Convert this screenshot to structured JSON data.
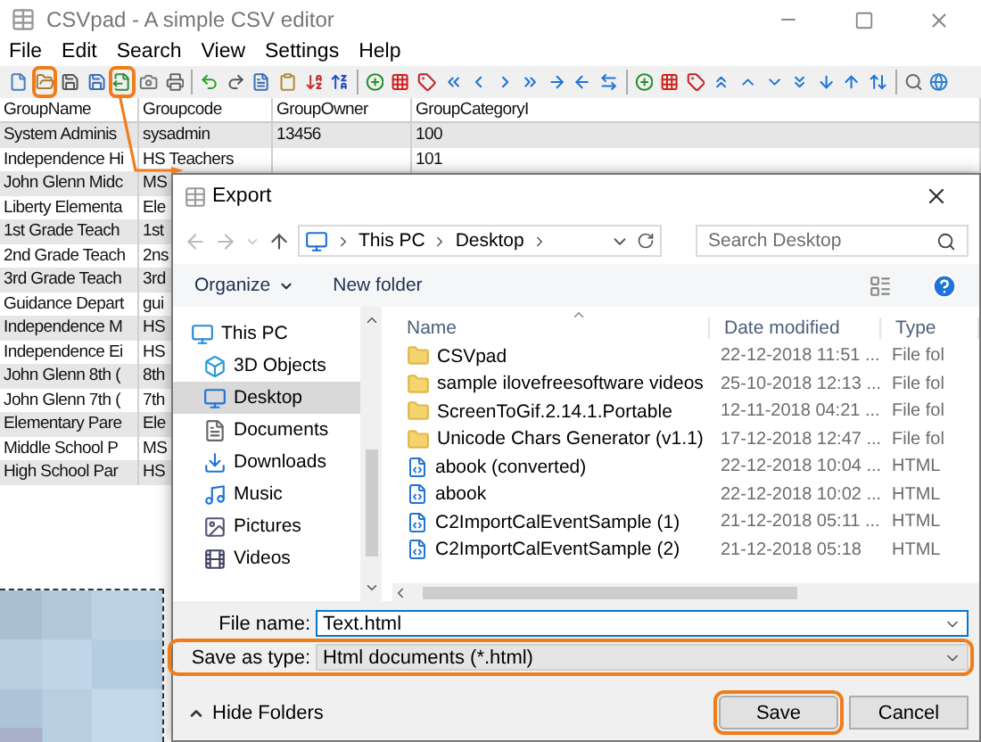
{
  "window": {
    "title": "CSVpad - A simple CSV editor"
  },
  "menu": [
    "File",
    "Edit",
    "Search",
    "View",
    "Settings",
    "Help"
  ],
  "toolbar": [
    {
      "kind": "new",
      "highlighted": false
    },
    {
      "kind": "open",
      "highlighted": true
    },
    {
      "kind": "save",
      "highlighted": false
    },
    {
      "kind": "saveas",
      "highlighted": false
    },
    {
      "kind": "export",
      "highlighted": true
    },
    {
      "kind": "camera",
      "highlighted": false
    },
    {
      "kind": "print",
      "highlighted": false
    },
    {
      "kind": "sep"
    },
    {
      "kind": "undo",
      "highlighted": false
    },
    {
      "kind": "redo",
      "highlighted": false
    },
    {
      "kind": "page",
      "highlighted": false
    },
    {
      "kind": "clipboard",
      "highlighted": false
    },
    {
      "kind": "sortaz",
      "highlighted": false
    },
    {
      "kind": "sortza",
      "highlighted": false
    },
    {
      "kind": "sep"
    },
    {
      "kind": "plus",
      "highlighted": false
    },
    {
      "kind": "grid",
      "highlighted": false
    },
    {
      "kind": "tag",
      "highlighted": false
    },
    {
      "kind": "dleft",
      "highlighted": false
    },
    {
      "kind": "left",
      "highlighted": false
    },
    {
      "kind": "right",
      "highlighted": false
    },
    {
      "kind": "dright",
      "highlighted": false
    },
    {
      "kind": "aright",
      "highlighted": false
    },
    {
      "kind": "aleft",
      "highlighted": false
    },
    {
      "kind": "swap",
      "highlighted": false
    },
    {
      "kind": "sep"
    },
    {
      "kind": "plus",
      "highlighted": false
    },
    {
      "kind": "grid",
      "highlighted": false
    },
    {
      "kind": "tag",
      "highlighted": false
    },
    {
      "kind": "dup",
      "highlighted": false
    },
    {
      "kind": "up",
      "highlighted": false
    },
    {
      "kind": "down",
      "highlighted": false
    },
    {
      "kind": "ddown",
      "highlighted": false
    },
    {
      "kind": "adown",
      "highlighted": false
    },
    {
      "kind": "aup",
      "highlighted": false
    },
    {
      "kind": "swapv",
      "highlighted": false
    },
    {
      "kind": "sep"
    },
    {
      "kind": "search",
      "highlighted": false
    },
    {
      "kind": "globe",
      "highlighted": false
    }
  ],
  "table": {
    "columns": [
      "GroupName",
      "Groupcode",
      "GroupOwner",
      "GroupCategoryI"
    ],
    "rows": [
      [
        "System Adminis",
        "sysadmin",
        "13456",
        "100"
      ],
      [
        "Independence Hi",
        "HS Teachers",
        null,
        "101"
      ],
      [
        "John Glenn Midc",
        "MS"
      ],
      [
        "Liberty Elementa",
        "Ele"
      ],
      [
        "1st Grade Teach",
        "1st"
      ],
      [
        "2nd Grade Teach",
        "2ns"
      ],
      [
        "3rd Grade Teach",
        "3rd"
      ],
      [
        "Guidance Depart",
        "gui"
      ],
      [
        "Independence M",
        "HS"
      ],
      [
        "Independence Ei",
        "HS"
      ],
      [
        "John Glenn 8th (",
        "8th"
      ],
      [
        "John Glenn 7th (",
        "7th"
      ],
      [
        "Elementary Pare",
        "Ele"
      ],
      [
        "Middle School P",
        "MS"
      ],
      [
        "High School Par",
        "HS"
      ]
    ]
  },
  "dialog": {
    "title": "Export",
    "breadcrumb": [
      "This PC",
      "Desktop"
    ],
    "search": {
      "placeholder": "Search Desktop"
    },
    "commands": [
      "Organize",
      "New folder"
    ],
    "nav": [
      {
        "kind": "pc",
        "label": "This PC",
        "selected": false,
        "children": [
          {
            "kind": "cube",
            "label": "3D Objects",
            "selected": false
          },
          {
            "kind": "desktop",
            "label": "Desktop",
            "selected": true
          },
          {
            "kind": "documents",
            "label": "Documents",
            "selected": false
          },
          {
            "kind": "downloads",
            "label": "Downloads",
            "selected": false
          },
          {
            "kind": "music",
            "label": "Music",
            "selected": false
          },
          {
            "kind": "pictures",
            "label": "Pictures",
            "selected": false
          },
          {
            "kind": "videos",
            "label": "Videos",
            "selected": false
          }
        ]
      }
    ],
    "columns": [
      "Name",
      "Date modified",
      "Type"
    ],
    "files": [
      {
        "kind": "folder",
        "name": "CSVpad",
        "date": "22-12-2018 11:51 ...",
        "type": "File fol"
      },
      {
        "kind": "folder",
        "name": "sample ilovefreesoftware videos",
        "date": "25-10-2018 12:13 ...",
        "type": "File fol"
      },
      {
        "kind": "folder",
        "name": "ScreenToGif.2.14.1.Portable",
        "date": "12-11-2018 04:21 ...",
        "type": "File fol"
      },
      {
        "kind": "folder",
        "name": "Unicode Chars Generator (v1.1)",
        "date": "17-12-2018 12:47 ...",
        "type": "File fol"
      },
      {
        "kind": "html",
        "name": "abook (converted)",
        "date": "22-12-2018 10:04 ...",
        "type": "HTML"
      },
      {
        "kind": "html",
        "name": "abook",
        "date": "22-12-2018 10:02 ...",
        "type": "HTML"
      },
      {
        "kind": "html",
        "name": "C2ImportCalEventSample (1)",
        "date": "21-12-2018 05:11 ...",
        "type": "HTML"
      },
      {
        "kind": "html",
        "name": "C2ImportCalEventSample (2)",
        "date": "21-12-2018 05:18",
        "type": "HTML"
      }
    ],
    "file_name": {
      "label": "File name:",
      "value": "Text.html"
    },
    "save_as_type": {
      "label": "Save as type:",
      "value": "Html documents (*.html)",
      "highlighted": true
    },
    "hide_folders": "Hide Folders",
    "buttons": [
      {
        "label": "Save",
        "highlighted": true
      },
      {
        "label": "Cancel",
        "highlighted": false
      }
    ]
  }
}
